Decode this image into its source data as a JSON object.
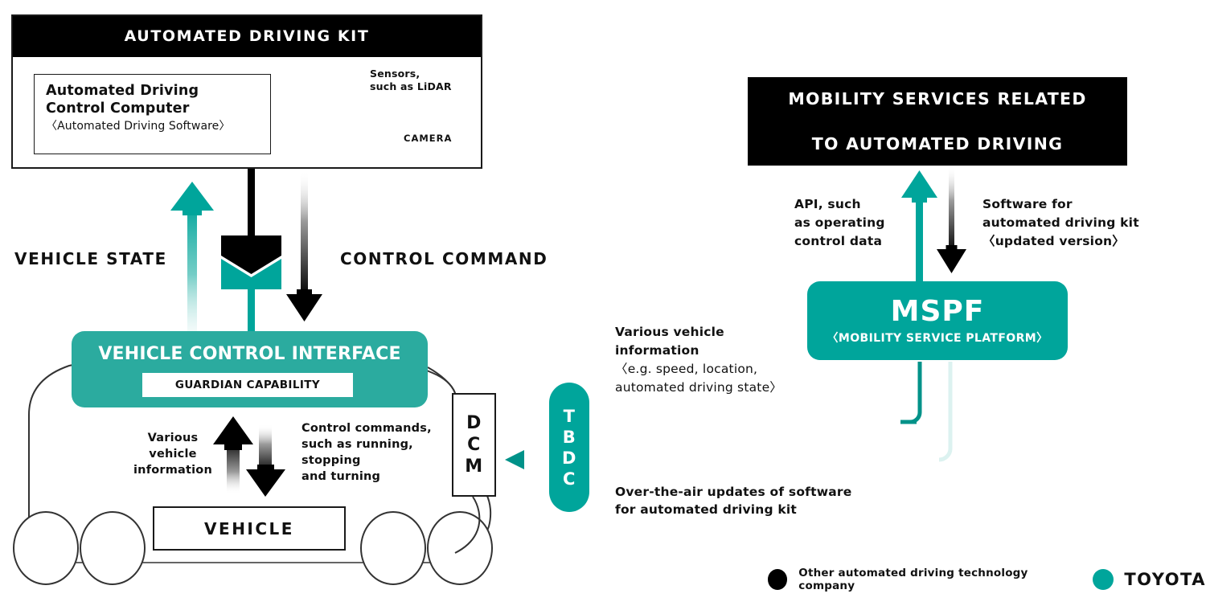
{
  "adk": {
    "title": "AUTOMATED DRIVING KIT",
    "control_computer": {
      "line1": "Automated Driving",
      "line2": "Control Computer",
      "subtitle": "〈Automated Driving Software〉"
    },
    "sensors_label_line1": "Sensors,",
    "sensors_label_line2": "such as LiDAR",
    "camera_label": "CAMERA"
  },
  "mobility_services": {
    "line1": "MOBILITY SERVICES RELATED",
    "line2": "TO AUTOMATED DRIVING"
  },
  "mspf": {
    "title": "MSPF",
    "subtitle": "〈MOBILITY SERVICE PLATFORM〉"
  },
  "vci": {
    "title": "VEHICLE CONTROL INTERFACE",
    "guardian": "GUARDIAN CAPABILITY"
  },
  "dcm": {
    "label": "D\nC\nM"
  },
  "tbdc": {
    "label": "T\nB\nD\nC"
  },
  "vehicle": {
    "label": "VEHICLE"
  },
  "flows": {
    "vehicle_state": "VEHICLE STATE",
    "control_command": "CONTROL COMMAND",
    "api": {
      "l1": "API, such",
      "l2": "as operating",
      "l3": "control data"
    },
    "software_update": {
      "l1": "Software for",
      "l2": "automated driving kit",
      "l3": "〈updated version〉"
    },
    "various_vehicle_information": {
      "l1": "Various vehicle",
      "l2": "information",
      "l3": "〈e.g. speed, location,",
      "l4": "automated driving state〉"
    },
    "ota": {
      "l1": "Over-the-air updates of software",
      "l2": "for automated driving kit"
    },
    "vehicle_info_small": {
      "l1": "Various",
      "l2": "vehicle",
      "l3": "information"
    },
    "control_commands_small": {
      "l1": "Control commands,",
      "l2": "such as running,",
      "l3": "stopping",
      "l4": "and turning"
    }
  },
  "legend": {
    "other_company": "Other automated driving technology company",
    "toyota": "TOYOTA",
    "other_color": "#000000",
    "toyota_color": "#00a59b"
  },
  "colors": {
    "teal": "#00a59b",
    "teal_light": "#2bab9f",
    "black": "#000000"
  }
}
